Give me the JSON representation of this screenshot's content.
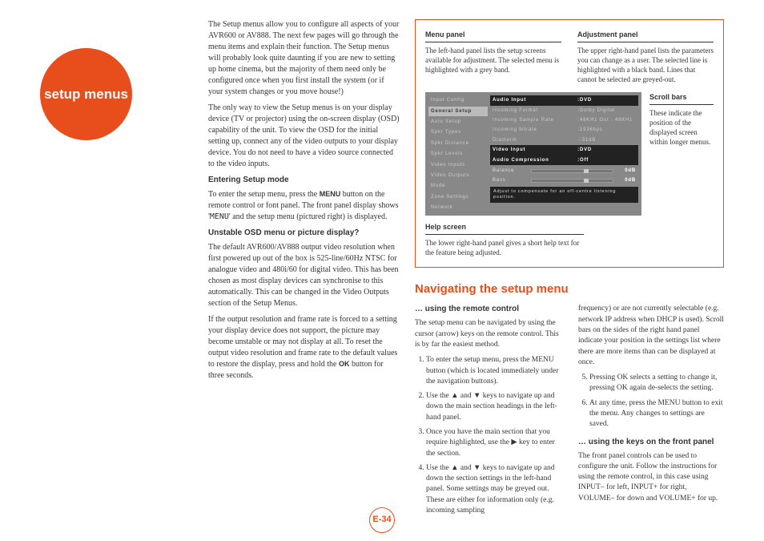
{
  "badge": "setup menus",
  "intro": {
    "p1": "The Setup menus allow you to configure all aspects of your AVR600 or AV888. The next few pages will go through the menu items and explain their function. The Setup menus will probably look quite daunting if you are new to setting up home cinema, but the majority of them need only be configured once when you first install the system (or if your system changes or you move house!)",
    "p2": "The only way to view the Setup menus is on your display device (TV or projector) using the on-screen display (OSD) capability of the unit. To view the OSD for the initial setting up, connect any of the video outputs to your display device. You do not need to have a video source connected to the video inputs."
  },
  "entering": {
    "title": "Entering Setup mode",
    "p1a": "To enter the setup menu, press the ",
    "menu": "MENU",
    "p1b": " button on the remote control or font panel. The front panel display shows '",
    "code": "MENU",
    "p1c": "' and the setup menu (pictured right) is displayed."
  },
  "unstable": {
    "title": "Unstable OSD menu or picture display?",
    "p1": "The default AVR600/AV888 output video resolution when first powered up out of the box is 525-line/60Hz NTSC for analogue video and 480i/60 for digital video. This has been chosen as most display devices can synchronise to this automatically. This can be changed in the Video Outputs section of the Setup Menus.",
    "p2a": "If the output resolution and frame rate is forced to a setting your display device does not support, the picture may become unstable or may not display at all. To reset the output video resolution and frame rate to the default values to restore the display, press and hold the ",
    "ok": "OK",
    "p2b": " button for three seconds."
  },
  "panels": {
    "menu": {
      "title": "Menu panel",
      "desc": "The left-hand panel lists the setup screens available for adjustment. The selected menu is highlighted with a grey band."
    },
    "adjustment": {
      "title": "Adjustment panel",
      "desc": "The upper right-hand panel lists the parameters you can change as a user. The selected line is highlighted with a black band. Lines that cannot be selected are greyed-out."
    },
    "scroll": {
      "title": "Scroll bars",
      "desc": "These indicate the position of the displayed screen within longer menus."
    },
    "help": {
      "title": "Help screen",
      "desc": "The lower right-hand panel gives a short help text for the feature being adjusted."
    }
  },
  "osd": {
    "left": [
      "Input Config",
      "General Setup",
      "Auto Setup",
      "Spkr Types",
      "Spkr Distance",
      "Spkr Levels",
      "Video Inputs",
      "Video Outputs",
      "Mode",
      "Zone Settings",
      "Network"
    ],
    "left_selected_index": 1,
    "right": [
      {
        "label": "Audio Input",
        "value": "DVD",
        "hilite": true
      },
      {
        "label": "Incoming Format",
        "value": "Dolby Digital"
      },
      {
        "label": "Incoming Sample Rate",
        "value": "48KHz Out : 48KHz"
      },
      {
        "label": "Incoming bitrate",
        "value": "1936bps"
      },
      {
        "label": "Dialnorm",
        "value": "-31dB"
      },
      {
        "label": "Video Input",
        "value": "DVD",
        "hilite": true
      },
      {
        "label": "Audio Compression",
        "value": "Off",
        "hilite": true
      }
    ],
    "sliders": [
      {
        "label": "Balance",
        "value": "0dB"
      },
      {
        "label": "Bass",
        "value": "0dB"
      }
    ],
    "help": "Adjust to compensate for an off-centre listening position."
  },
  "nav": {
    "title": "Navigating the setup menu",
    "remote": {
      "subhead": "… using the remote control",
      "intro": "The setup menu can be navigated by using the cursor (arrow) keys on the remote control. This is by far the easiest method.",
      "steps": [
        "To enter the setup menu, press the MENU button (which is located immediately under the navigation buttons).",
        "Use the ▲ and ▼ keys to navigate up and down the main section headings in the left-hand panel.",
        "Once you have the main section that you require highlighted, use the ▶ key to enter the section.",
        "Use the ▲ and ▼ keys to navigate up and down the section settings in the left-hand panel. Some settings may be greyed out. These are either for information only (e.g. incoming sampling"
      ],
      "cont": "frequency) or are not currently selectable (e.g. network IP address when DHCP is used). Scroll bars on the sides of the right hand panel indicate your position in the settings list where there are more items than can be displayed at once.",
      "step5": "Pressing OK selects a setting to change it, pressing OK again de-selects the setting.",
      "step6": "At any time, press the MENU button to exit the menu. Any changes to settings are saved."
    },
    "front": {
      "subhead": "… using the keys on the front panel",
      "p": "The front panel controls can be used to configure the unit. Follow the instructions for using the remote control, in this case using INPUT– for left, INPUT+ for right, VOLUME– for down and VOLUME+ for up."
    }
  },
  "page": "E-34"
}
